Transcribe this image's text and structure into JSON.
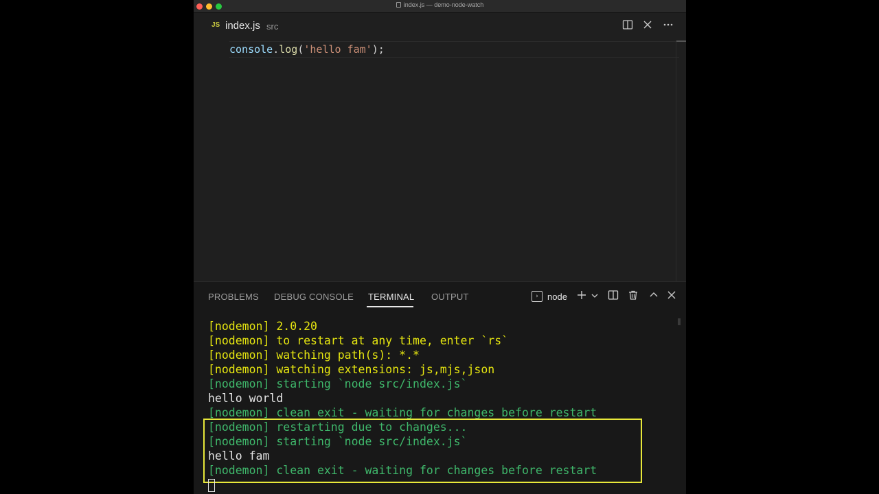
{
  "window": {
    "title": "index.js — demo-node-watch"
  },
  "editor_tab": {
    "lang_badge": "JS",
    "file_name": "index.js",
    "folder": "src"
  },
  "editor": {
    "code": {
      "ident": "console",
      "dot": ".",
      "fn": "log",
      "open": "(",
      "str": "'hello fam'",
      "close": ");"
    }
  },
  "panel": {
    "tabs": [
      "PROBLEMS",
      "DEBUG CONSOLE",
      "TERMINAL",
      "OUTPUT"
    ],
    "active_tab": "TERMINAL",
    "terminal_name": "node"
  },
  "terminal": {
    "lines": [
      {
        "text": "[nodemon] 2.0.20",
        "color": "#e5e510"
      },
      {
        "text": "[nodemon] to restart at any time, enter `rs`",
        "color": "#e5e510"
      },
      {
        "text": "[nodemon] watching path(s): *.*",
        "color": "#e5e510"
      },
      {
        "text": "[nodemon] watching extensions: js,mjs,json",
        "color": "#e5e510"
      },
      {
        "text": "[nodemon] starting `node src/index.js`",
        "color": "#3fb86b"
      },
      {
        "text": "hello world",
        "color": "#e6e6e6"
      },
      {
        "text": "[nodemon] clean exit - waiting for changes before restart",
        "color": "#3fb86b"
      },
      {
        "text": "[nodemon] restarting due to changes...",
        "color": "#3fb86b"
      },
      {
        "text": "[nodemon] starting `node src/index.js`",
        "color": "#3fb86b"
      },
      {
        "text": "hello fam",
        "color": "#e6e6e6"
      },
      {
        "text": "[nodemon] clean exit - waiting for changes before restart",
        "color": "#3fb86b"
      }
    ]
  },
  "icons": {
    "split_editor": "split-editor-icon",
    "close": "close-icon",
    "more": "more-actions-icon",
    "terminal": "terminal-icon",
    "new_terminal": "plus-icon",
    "terminal_dropdown": "chevron-down-icon",
    "split_terminal": "split-terminal-icon",
    "kill_terminal": "trash-icon",
    "maximize_panel": "chevron-up-icon",
    "close_panel": "close-icon"
  },
  "colors": {
    "highlight": "#e8e83a",
    "accent_yellow": "#e5e510",
    "accent_green": "#3fb86b"
  }
}
